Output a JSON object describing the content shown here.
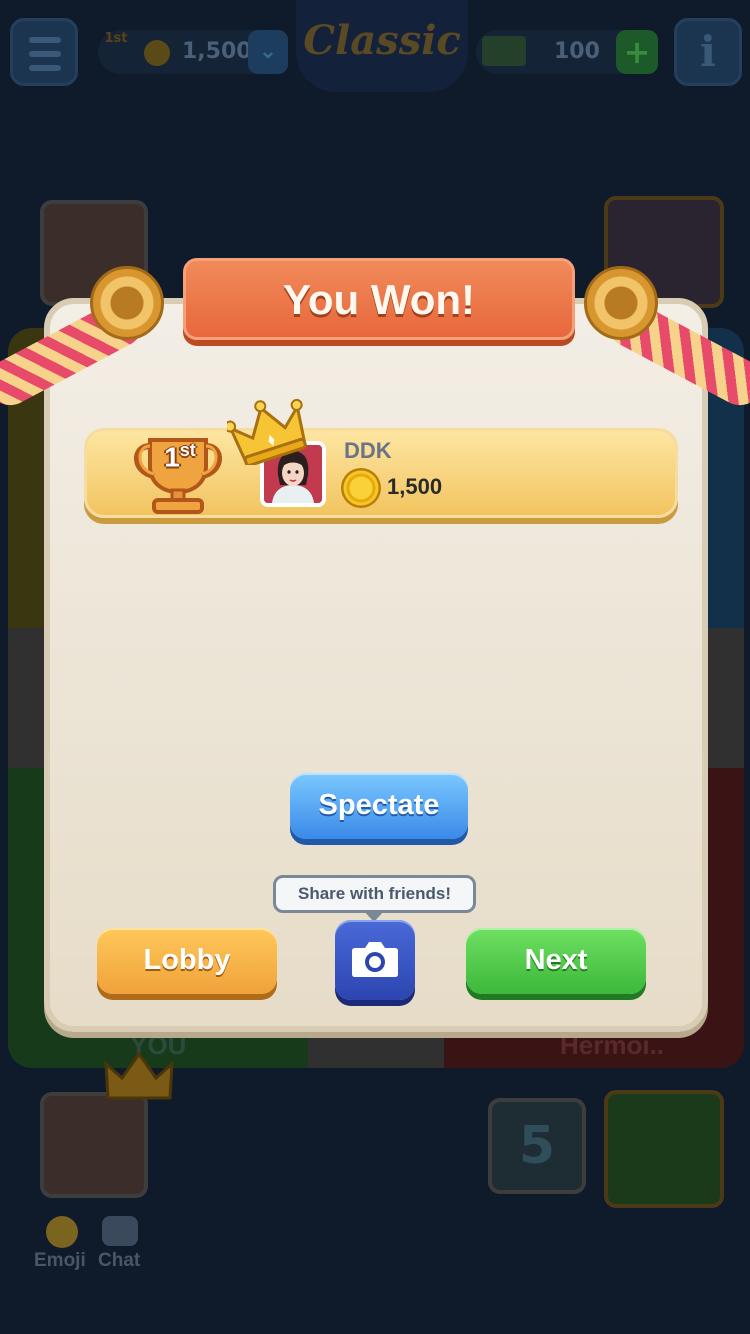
{
  "header": {
    "rank_badge": "1st",
    "coins": "1,500",
    "game_mode": "Classic",
    "cash": "100"
  },
  "board": {
    "you_label": "YOU",
    "opponent_label": "Hermoi..",
    "dice_value": "5"
  },
  "modal": {
    "title": "You Won!",
    "winner": {
      "rank": "1",
      "rank_suffix": "st",
      "name": "DDK",
      "coins": "1,500"
    },
    "spectate_label": "Spectate",
    "share_tooltip": "Share with friends!",
    "lobby_label": "Lobby",
    "next_label": "Next"
  },
  "bottom_controls": {
    "emoji_label": "Emoji",
    "chat_label": "Chat"
  },
  "colors": {
    "title_ribbon": "#e8683c",
    "spectate": "#3a8ae8",
    "lobby": "#f0a23a",
    "next": "#3cb83a",
    "camera": "#2c45b0",
    "winner_row": "#f2c460"
  },
  "icons": {
    "menu": "hamburger-icon",
    "coins": "coin-icon",
    "cash": "cash-icon",
    "add": "plus-icon",
    "info": "info-icon",
    "camera": "camera-icon",
    "trophy": "trophy-icon",
    "crown": "crown-icon"
  }
}
